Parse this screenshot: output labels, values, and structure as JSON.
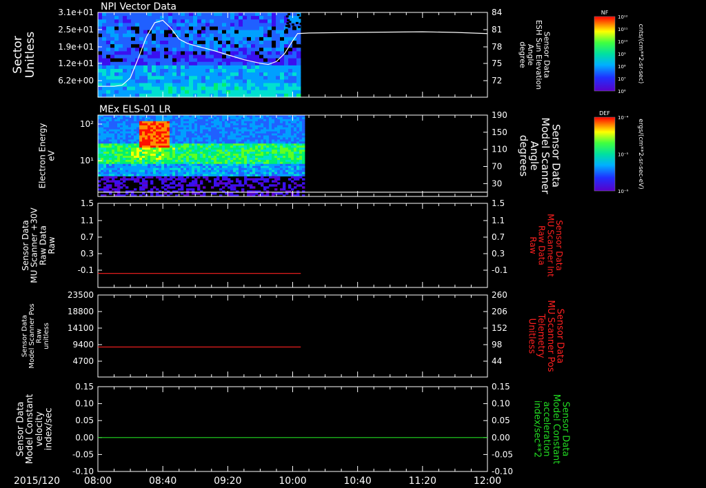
{
  "chart_data": {
    "time_axis": {
      "date_label": "2015/120",
      "ticks": [
        "08:00",
        "08:40",
        "09:20",
        "10:00",
        "10:40",
        "11:20",
        "12:00"
      ]
    },
    "panels": [
      {
        "id": "npi",
        "type": "heatmap",
        "title": "NPI Vector Data",
        "ylabel_left": [
          "Sector",
          "Unitless"
        ],
        "yticks_left": [
          "3.1e+01",
          "2.5e+01",
          "1.9e+01",
          "1.2e+01",
          "6.2e+00"
        ],
        "ylabel_right": [
          "Sensor Data",
          "ESH Sun Elevation",
          "Angle",
          "degree"
        ],
        "yticks_right": [
          "84",
          "81",
          "78",
          "75",
          "72"
        ],
        "yrange_right": [
          70,
          84
        ],
        "colorbar": {
          "label": "NF",
          "units": "cnts/(cm**2-sr-sec)",
          "ticks": [
            "10¹²",
            "10¹¹",
            "10¹⁰",
            "10⁹",
            "10⁸",
            "10⁷",
            "10⁶"
          ]
        },
        "line_series": {
          "color": "#ffffff",
          "x": [
            "08:00",
            "08:05",
            "08:10",
            "08:15",
            "08:20",
            "08:25",
            "08:30",
            "08:35",
            "08:40",
            "08:45",
            "08:50",
            "08:55",
            "09:00",
            "09:10",
            "09:20",
            "09:30",
            "09:40",
            "09:45",
            "09:50",
            "09:55",
            "10:00",
            "10:03",
            "10:10",
            "10:40",
            "11:20",
            "11:40",
            "12:00"
          ],
          "y": [
            71.8,
            71.8,
            71.8,
            72.0,
            73.2,
            76.5,
            80.0,
            82.3,
            82.7,
            81.4,
            79.6,
            78.9,
            78.5,
            77.8,
            77.0,
            76.2,
            75.6,
            75.4,
            75.9,
            77.2,
            79.3,
            80.5,
            80.6,
            80.7,
            80.8,
            80.7,
            80.5
          ]
        }
      },
      {
        "id": "els",
        "type": "heatmap",
        "title": "MEx ELS-01 LR",
        "ylabel_left": [
          "Electron Energy",
          "eV"
        ],
        "yticks_left": [
          "10²",
          "10¹"
        ],
        "ylabel_right": [
          "Sensor Data",
          "Model Scanner",
          "Angle",
          "degrees"
        ],
        "yticks_right": [
          "190",
          "150",
          "110",
          "70",
          "30"
        ],
        "yrange_right": [
          0,
          190
        ],
        "colorbar": {
          "label": "DEF",
          "units": "ergs/(cm**2-sr-sec-eV)",
          "ticks": [
            "10⁻⁴",
            "10⁻⁵",
            "10⁻⁶"
          ]
        },
        "line_series": {
          "color": "#ffffff",
          "x": [
            "08:00",
            "12:00"
          ],
          "y": [
            10,
            10
          ]
        }
      },
      {
        "id": "mu_raw",
        "type": "line",
        "ylabel_left": [
          "Sensor Data",
          "MU Scanner +30V",
          "Raw Data",
          "Raw"
        ],
        "yticks_left": [
          "1.5",
          "1.1",
          "0.7",
          "0.3",
          "-0.1"
        ],
        "yrange_left": [
          -0.3,
          1.5
        ],
        "ylabel_right": [
          "Sensor Data",
          "MU Scanner Int",
          "Raw Data",
          "Raw"
        ],
        "ylabel_right_color": "#ff2020",
        "yticks_right": [
          "1.5",
          "1.1",
          "0.7",
          "0.3",
          "-0.1"
        ],
        "series": [
          {
            "color": "#ff2020",
            "x": [
              "08:00",
              "10:05"
            ],
            "y": [
              0.0,
              0.0
            ]
          }
        ]
      },
      {
        "id": "mu_pos",
        "type": "line",
        "ylabel_left": [
          "Sensor Data",
          "Model Scanner Pos",
          "Raw",
          "unitless"
        ],
        "yticks_left": [
          "23500",
          "18800",
          "14100",
          "9400",
          "4700"
        ],
        "yrange_left": [
          0,
          23500
        ],
        "ylabel_right": [
          "Sensor Data",
          "MU Scanner Pos",
          "Telemetry",
          "Unitless"
        ],
        "ylabel_right_color": "#ff2020",
        "yticks_right": [
          "260",
          "206",
          "152",
          "98",
          "44"
        ],
        "series": [
          {
            "color": "#ff2020",
            "x": [
              "08:00",
              "10:05"
            ],
            "y": [
              8600,
              8600
            ]
          }
        ]
      },
      {
        "id": "model_const",
        "type": "line",
        "ylabel_left": [
          "Sensor Data",
          "Model Constant",
          "velocity",
          "index/sec"
        ],
        "yticks_left": [
          "0.15",
          "0.10",
          "0.05",
          "0.00",
          "-0.05",
          "-0.10"
        ],
        "yrange_left": [
          -0.1,
          0.15
        ],
        "ylabel_right": [
          "Sensor Data",
          "Model Constant",
          "acceleration",
          "index/sec**2"
        ],
        "ylabel_right_color": "#22dd22",
        "yticks_right": [
          "0.15",
          "0.10",
          "0.05",
          "0.00",
          "-0.05",
          "-0.10"
        ],
        "series": [
          {
            "color": "#22dd22",
            "x": [
              "08:00",
              "12:00"
            ],
            "y": [
              0.0,
              0.0
            ]
          }
        ]
      }
    ]
  }
}
